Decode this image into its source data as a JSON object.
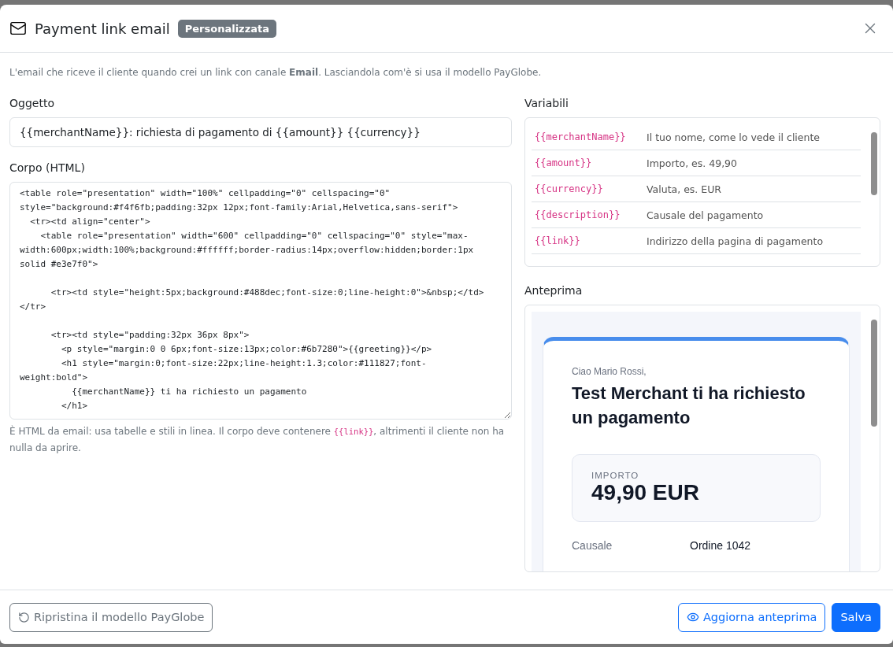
{
  "modal": {
    "title": "Payment link email",
    "badge": "Personalizzata",
    "description": "L'email che riceve il cliente quando crei un link con canale **Email**. Lasciandola com'è si usa il modello PayGlobe."
  },
  "subject": {
    "label": "Oggetto",
    "value": "{{merchantName}}: richiesta di pagamento di {{amount}} {{currency}}"
  },
  "body": {
    "label": "Corpo (HTML)",
    "value": "<table role=\"presentation\" width=\"100%\" cellpadding=\"0\" cellspacing=\"0\" style=\"background:#f4f6fb;padding:32px 12px;font-family:Arial,Helvetica,sans-serif\">\n  <tr><td align=\"center\">\n    <table role=\"presentation\" width=\"600\" cellpadding=\"0\" cellspacing=\"0\" style=\"max-width:600px;width:100%;background:#ffffff;border-radius:14px;overflow:hidden;border:1px solid #e3e7f0\">\n\n      <tr><td style=\"height:5px;background:#488dec;font-size:0;line-height:0\">&nbsp;</td></tr>\n\n      <tr><td style=\"padding:32px 36px 8px\">\n        <p style=\"margin:0 0 6px;font-size:13px;color:#6b7280\">{{greeting}}</p>\n        <h1 style=\"margin:0;font-size:22px;line-height:1.3;color:#111827;font-weight:bold\">\n          {{merchantName}} ti ha richiesto un pagamento\n        </h1>",
    "hint": {
      "before": "È HTML da email: usa tabelle e stili in linea. Il corpo deve contenere ",
      "code": "{{link}}",
      "after": ", altrimenti il cliente non ha nulla da aprire."
    }
  },
  "variables": {
    "label": "Variabili",
    "rows": [
      {
        "name": "{{merchantName}}",
        "description": "Il tuo nome, come lo vede il cliente"
      },
      {
        "name": "{{amount}}",
        "description": "Importo, es. 49,90"
      },
      {
        "name": "{{currency}}",
        "description": "Valuta, es. EUR"
      },
      {
        "name": "{{description}}",
        "description": "Causale del pagamento"
      },
      {
        "name": "{{link}}",
        "description": "Indirizzo della pagina di pagamento"
      }
    ]
  },
  "preview": {
    "label": "Anteprima",
    "greeting": "Ciao Mario Rossi,",
    "heading": "Test Merchant ti ha richiesto un pagamento",
    "amount_label": "IMPORTO",
    "amount": "49,90 EUR",
    "details": [
      {
        "label": "Causale",
        "value": "Ordine 1042"
      }
    ]
  },
  "footer": {
    "reset": "Ripristina il modello PayGlobe",
    "refresh": "Aggiorna anteprima",
    "save": "Salva"
  }
}
